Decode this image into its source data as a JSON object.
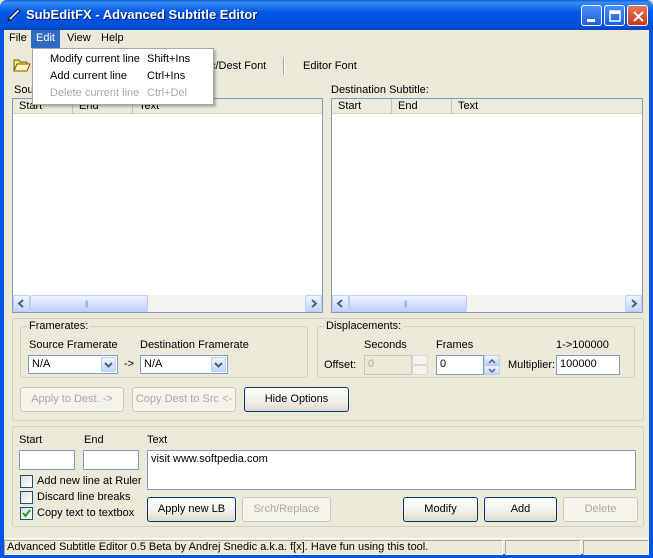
{
  "window": {
    "title": "SubEditFX - Advanced Subtitle Editor",
    "titlebar_color": "#0055e5"
  },
  "menu": {
    "items": [
      "File",
      "Edit",
      "View",
      "Help"
    ],
    "active": "Edit",
    "edit_dropdown": [
      {
        "label": "Modify current line",
        "shortcut": "Shift+Ins",
        "enabled": true
      },
      {
        "label": "Add current line",
        "shortcut": "Ctrl+Ins",
        "enabled": true
      },
      {
        "label": "Delete current line",
        "shortcut": "Ctrl+Del",
        "enabled": false
      }
    ]
  },
  "toolbar": {
    "open_icon": "folder-open-icon",
    "src_dest_font": "c/Dest Font",
    "editor_font": "Editor Font"
  },
  "source_panel": {
    "label": "Sou",
    "columns": [
      "Start",
      "End",
      "Text"
    ]
  },
  "dest_panel": {
    "label": "Destination Subtitle:",
    "columns": [
      "Start",
      "End",
      "Text"
    ]
  },
  "framerates": {
    "group_title": "Framerates:",
    "source_label": "Source Framerate",
    "dest_label": "Destination Framerate",
    "source_value": "N/A",
    "dest_value": "N/A",
    "arrow": "->"
  },
  "displacements": {
    "group_title": "Displacements:",
    "seconds_label": "Seconds",
    "frames_label": "Frames",
    "ratio_label": "1->100000",
    "offset_label": "Offset:",
    "seconds_value": "0",
    "frames_value": "0",
    "multiplier_label": "Multiplier:",
    "multiplier_value": "100000"
  },
  "actions": {
    "apply_to_dest": "Apply to Dest. ->",
    "copy_dest_to_src": "Copy Dest to Src <-",
    "hide_options": "Hide Options"
  },
  "editor": {
    "start_label": "Start",
    "end_label": "End",
    "text_label": "Text",
    "start_value": "",
    "end_value": "",
    "text_value": "visit www.softpedia.com",
    "add_new_line_at_ruler": "Add new line at Ruler",
    "discard_line_breaks": "Discard line breaks",
    "copy_text_to_textbox": "Copy text to textbox",
    "checks": {
      "add_new_line_at_ruler": false,
      "discard_line_breaks": false,
      "copy_text_to_textbox": true
    },
    "apply_new_lb": "Apply new LB",
    "srch_replace": "Srch/Replace",
    "modify": "Modify",
    "add": "Add",
    "delete": "Delete"
  },
  "status": {
    "text": "Advanced Subtitle Editor 0.5 Beta by Andrej Snedic a.k.a. f[x]. Have fun using this tool."
  }
}
